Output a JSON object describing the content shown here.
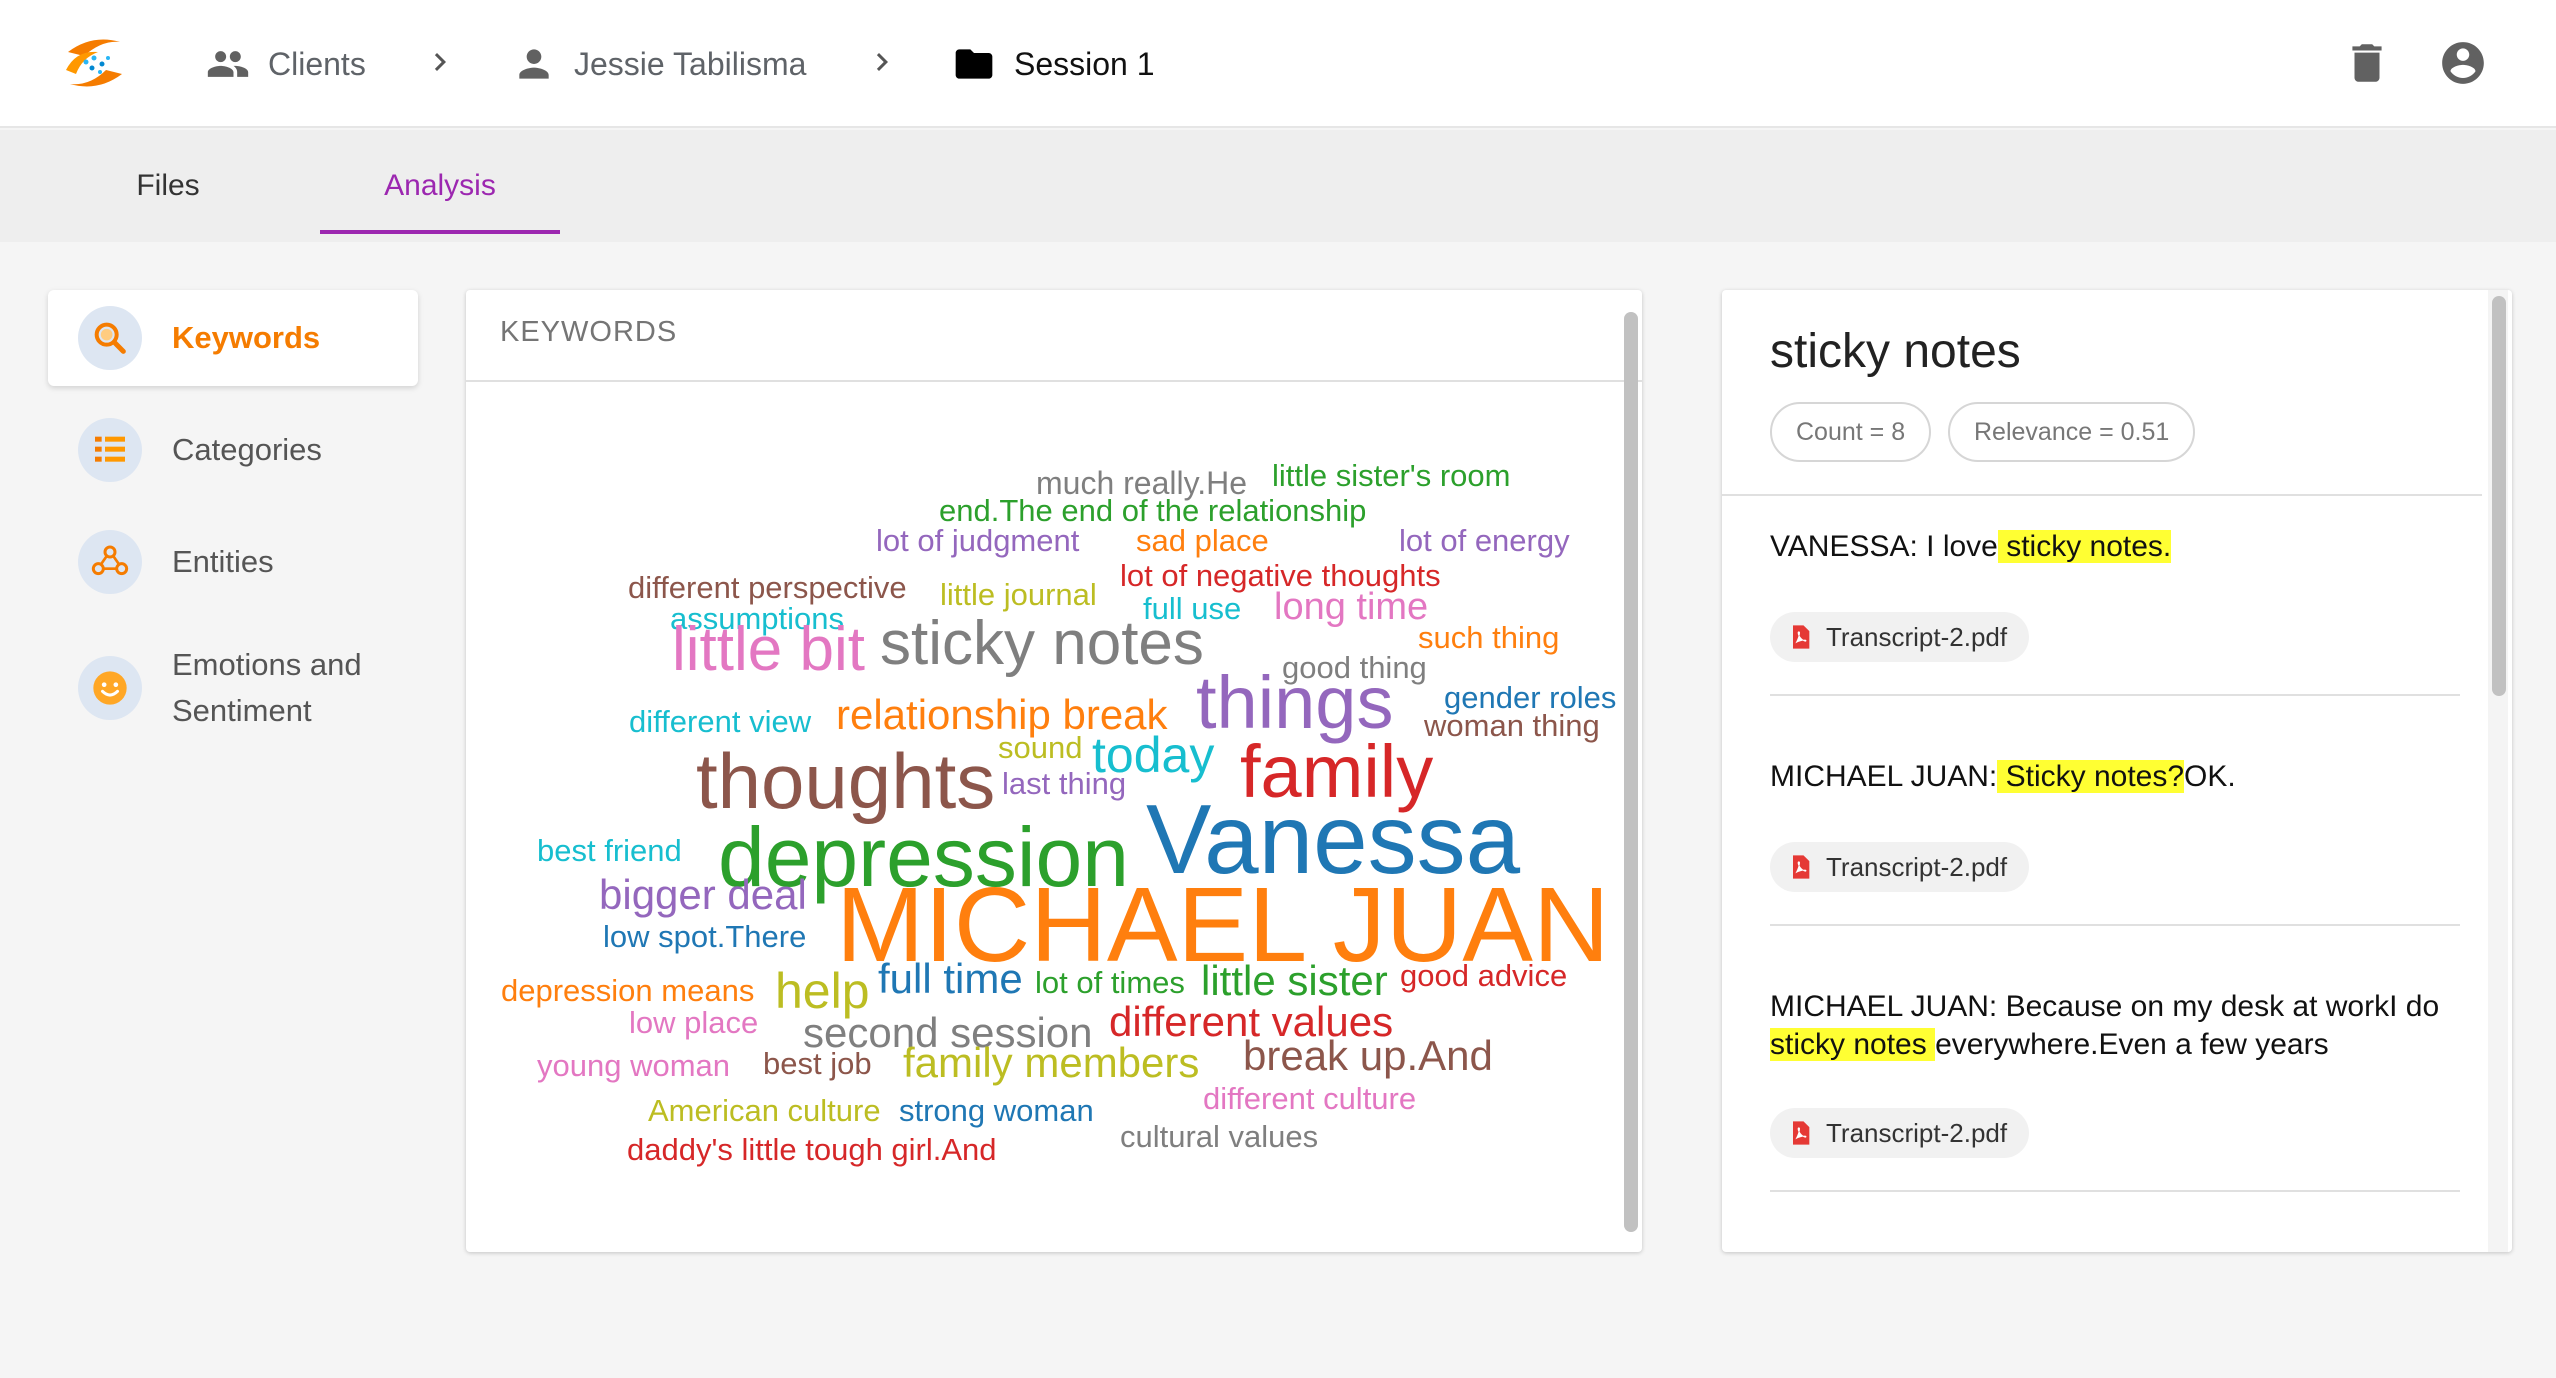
{
  "breadcrumb": {
    "clients": "Clients",
    "client_name": "Jessie Tabilisma",
    "session": "Session 1"
  },
  "tabs": [
    {
      "label": "Files",
      "active": false
    },
    {
      "label": "Analysis",
      "active": true
    }
  ],
  "sidebar": {
    "items": [
      {
        "label": "Keywords",
        "icon": "search-icon",
        "active": true
      },
      {
        "label": "Categories",
        "icon": "list-icon",
        "active": false
      },
      {
        "label": "Entities",
        "icon": "entities-icon",
        "active": false
      },
      {
        "label": "Emotions and Sentiment",
        "icon": "smiley-icon",
        "active": false
      }
    ]
  },
  "keywords_panel": {
    "header": "KEYWORDS",
    "words": [
      {
        "text": "much really.He",
        "color": "#7f7f7f"
      },
      {
        "text": "little sister's room",
        "color": "#2ca02c"
      },
      {
        "text": "end.The end of the relationship",
        "color": "#2ca02c"
      },
      {
        "text": "lot of judgment",
        "color": "#9467bd"
      },
      {
        "text": "sad place",
        "color": "#ff7f0e"
      },
      {
        "text": "lot of energy",
        "color": "#9467bd"
      },
      {
        "text": "different perspective",
        "color": "#8c564b"
      },
      {
        "text": "little journal",
        "color": "#bcbd22"
      },
      {
        "text": "lot of negative thoughts",
        "color": "#d62728"
      },
      {
        "text": "assumptions",
        "color": "#17becf"
      },
      {
        "text": "full use",
        "color": "#17becf"
      },
      {
        "text": "long time",
        "color": "#e377c2"
      },
      {
        "text": "little bit",
        "color": "#e377c2"
      },
      {
        "text": "sticky notes",
        "color": "#7f7f7f"
      },
      {
        "text": "such thing",
        "color": "#ff7f0e"
      },
      {
        "text": "good thing",
        "color": "#7f7f7f"
      },
      {
        "text": "gender roles",
        "color": "#1f77b4"
      },
      {
        "text": "things",
        "color": "#9467bd"
      },
      {
        "text": "different view",
        "color": "#17becf"
      },
      {
        "text": "relationship break",
        "color": "#ff7f0e"
      },
      {
        "text": "woman thing",
        "color": "#8c564b"
      },
      {
        "text": "sound",
        "color": "#bcbd22"
      },
      {
        "text": "today",
        "color": "#17becf"
      },
      {
        "text": "thoughts",
        "color": "#8c564b"
      },
      {
        "text": "last thing",
        "color": "#9467bd"
      },
      {
        "text": "family",
        "color": "#d62728"
      },
      {
        "text": "best friend",
        "color": "#17becf"
      },
      {
        "text": "depression",
        "color": "#2ca02c"
      },
      {
        "text": "Vanessa",
        "color": "#1f77b4"
      },
      {
        "text": "bigger deal",
        "color": "#9467bd"
      },
      {
        "text": "low spot.There",
        "color": "#1f77b4"
      },
      {
        "text": "MICHAEL JUAN",
        "color": "#ff7f0e"
      },
      {
        "text": "depression means",
        "color": "#ff7f0e"
      },
      {
        "text": "help",
        "color": "#bcbd22"
      },
      {
        "text": "full time",
        "color": "#1f77b4"
      },
      {
        "text": "lot of times",
        "color": "#2ca02c"
      },
      {
        "text": "little sister",
        "color": "#2ca02c"
      },
      {
        "text": "good advice",
        "color": "#d62728"
      },
      {
        "text": "low place",
        "color": "#e377c2"
      },
      {
        "text": "second session",
        "color": "#7f7f7f"
      },
      {
        "text": "different values",
        "color": "#d62728"
      },
      {
        "text": "young woman",
        "color": "#e377c2"
      },
      {
        "text": "best job",
        "color": "#8c564b"
      },
      {
        "text": "family members",
        "color": "#bcbd22"
      },
      {
        "text": "break up.And",
        "color": "#8c564b"
      },
      {
        "text": "different culture",
        "color": "#e377c2"
      },
      {
        "text": "American culture",
        "color": "#bcbd22"
      },
      {
        "text": "strong woman",
        "color": "#1f77b4"
      },
      {
        "text": "cultural values",
        "color": "#7f7f7f"
      },
      {
        "text": "daddy's little tough girl.And",
        "color": "#d62728"
      }
    ]
  },
  "detail": {
    "title": "sticky notes",
    "count_label": "Count = 8",
    "relevance_label": "Relevance = 0.51",
    "entries": [
      {
        "before": "VANESSA: I love",
        "highlight": " sticky notes.",
        "after": "",
        "file": "Transcript-2.pdf"
      },
      {
        "before": "MICHAEL JUAN:",
        "highlight": " Sticky notes?",
        "after": "OK.",
        "file": "Transcript-2.pdf"
      },
      {
        "before": "MICHAEL JUAN: Because on my desk at workI do",
        "highlight": " sticky notes ",
        "after": "everywhere.Even a few years",
        "file": "Transcript-2.pdf"
      }
    ]
  }
}
